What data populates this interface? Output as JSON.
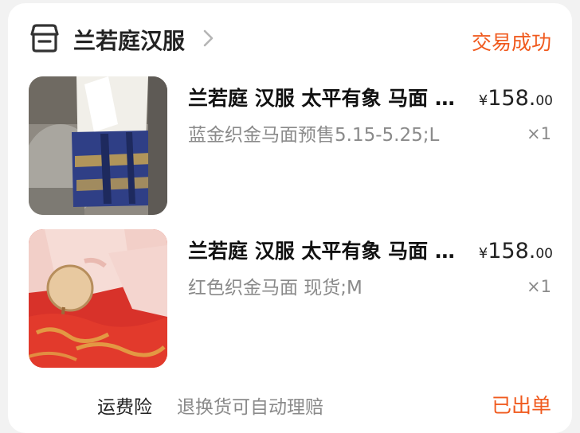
{
  "shop": {
    "name": "兰若庭汉服",
    "icon": "shop-icon",
    "status": "交易成功"
  },
  "items": [
    {
      "title": "兰若庭 汉服 太平有象 马面 …",
      "variant": "蓝金织金马面预售5.15-5.25;L",
      "currency": "¥",
      "price_int": "158.",
      "price_dec": "00",
      "qty": "×1"
    },
    {
      "title": "兰若庭 汉服 太平有象 马面 …",
      "variant": "红色织金马面 现货;M",
      "currency": "¥",
      "price_int": "158.",
      "price_dec": "00",
      "qty": "×1"
    }
  ],
  "footer": {
    "insurance_label": "运费险",
    "insurance_desc": "退换货可自动理赔",
    "status": "已出单"
  },
  "colors": {
    "accent": "#f05a1e",
    "muted": "#8a8a8a",
    "text": "#222222"
  }
}
